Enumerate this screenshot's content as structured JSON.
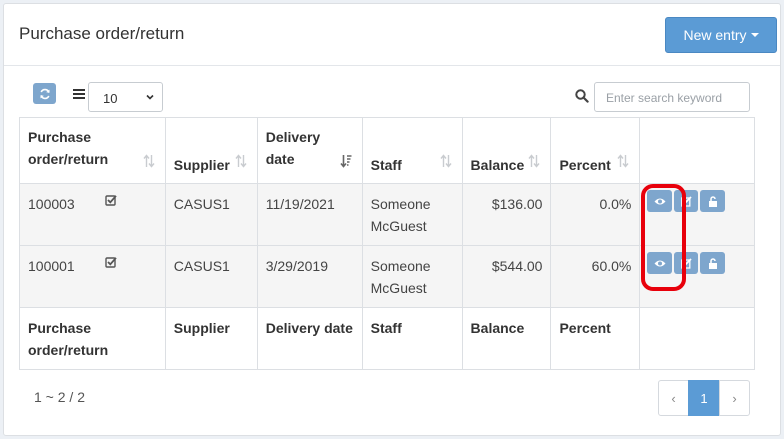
{
  "header": {
    "title": "Purchase order/return",
    "new_entry_label": "New entry"
  },
  "toolbar": {
    "page_size": "10",
    "search_placeholder": "Enter search keyword"
  },
  "table": {
    "columns": [
      {
        "label": "Purchase order/return",
        "top": "Purchase",
        "bottom": "order/return"
      },
      {
        "label": "Supplier"
      },
      {
        "label": "Delivery date",
        "top": "Delivery",
        "bottom": "date"
      },
      {
        "label": "Staff"
      },
      {
        "label": "Balance"
      },
      {
        "label": "Percent"
      }
    ],
    "rows": [
      {
        "po": "100003",
        "supplier": "CASUS1",
        "date": "11/19/2021",
        "staff_1": "Someone",
        "staff_2": "McGuest",
        "balance": "$136.00",
        "percent": "0.0%"
      },
      {
        "po": "100001",
        "supplier": "CASUS1",
        "date": "3/29/2019",
        "staff_1": "Someone",
        "staff_2": "McGuest",
        "balance": "$544.00",
        "percent": "60.0%"
      }
    ],
    "footer": {
      "po_1": "Purchase",
      "po_2": "order/return",
      "supplier": "Supplier",
      "date": "Delivery date",
      "staff": "Staff",
      "balance": "Balance",
      "percent": "Percent"
    }
  },
  "pagination": {
    "summary": "1 ~ 2 / 2",
    "prev": "‹",
    "current": "1",
    "next": "›"
  },
  "colors": {
    "primary": "#5b9bd5",
    "action_button": "#7ea6cd",
    "highlight": "#e8000b"
  }
}
